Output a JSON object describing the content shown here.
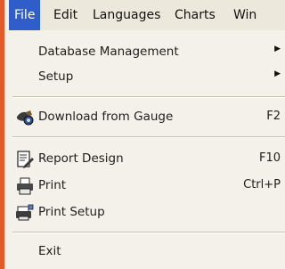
{
  "menubar": {
    "items": [
      {
        "label": "File"
      },
      {
        "label": "Edit"
      },
      {
        "label": "Languages"
      },
      {
        "label": "Charts"
      },
      {
        "label": "Win"
      }
    ],
    "active_index": 0
  },
  "file_menu": {
    "items": [
      {
        "label": "Database Management",
        "submenu": true
      },
      {
        "label": "Setup",
        "submenu": true
      },
      {
        "label": "Download from Gauge",
        "shortcut": "F2",
        "icon": "download-gauge-icon"
      },
      {
        "label": "Report Design",
        "shortcut": "F10",
        "icon": "report-design-icon"
      },
      {
        "label": "Print",
        "shortcut": "Ctrl+P",
        "icon": "printer-icon"
      },
      {
        "label": "Print Setup",
        "icon": "print-setup-icon"
      },
      {
        "label": "Exit"
      }
    ],
    "submenu_arrow": "▶"
  },
  "colors": {
    "highlight": "#2f5dc9",
    "frame_border": "#e35a2a",
    "menu_background": "#f4f1ea"
  }
}
